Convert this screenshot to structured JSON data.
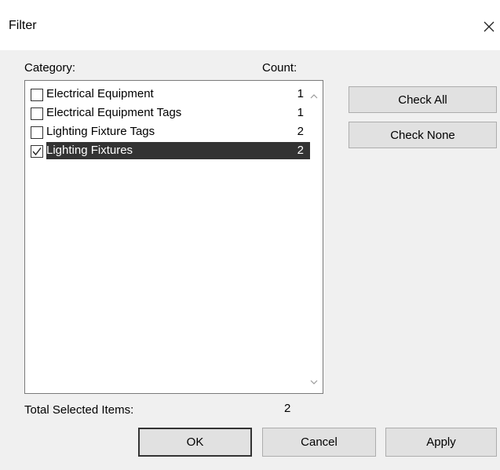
{
  "dialog": {
    "title": "Filter",
    "close_icon": "close-icon"
  },
  "headers": {
    "category": "Category:",
    "count": "Count:"
  },
  "categories": [
    {
      "label": "Electrical Equipment",
      "count": "1",
      "checked": false,
      "selected": false
    },
    {
      "label": "Electrical Equipment Tags",
      "count": "1",
      "checked": false,
      "selected": false
    },
    {
      "label": "Lighting Fixture Tags",
      "count": "2",
      "checked": false,
      "selected": false
    },
    {
      "label": "Lighting Fixtures",
      "count": "2",
      "checked": true,
      "selected": true
    }
  ],
  "side_buttons": {
    "check_all": "Check All",
    "check_none": "Check None"
  },
  "footer": {
    "total_label": "Total Selected Items:",
    "total_value": "2"
  },
  "buttons": {
    "ok": "OK",
    "cancel": "Cancel",
    "apply": "Apply"
  },
  "colors": {
    "selection_bg": "#333333",
    "dialog_bg": "#f0f0f0"
  }
}
